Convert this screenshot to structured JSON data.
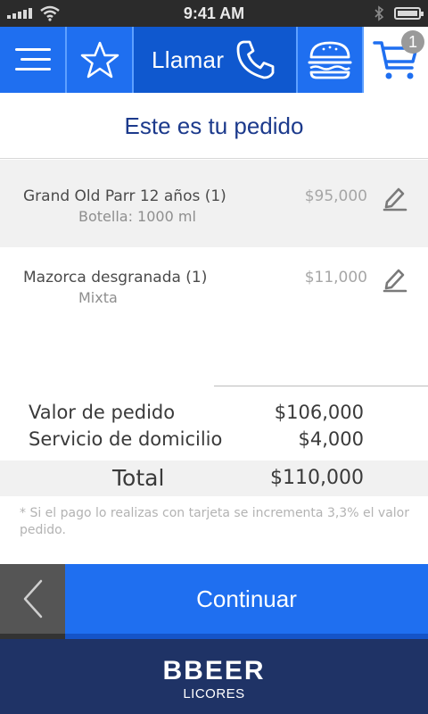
{
  "status_bar": {
    "time": "9:41 AM",
    "icons": [
      "signal-icon",
      "wifi-icon",
      "bluetooth-icon",
      "battery-icon"
    ]
  },
  "nav": {
    "menu_icon": "menu-icon",
    "favorites_icon": "star-icon",
    "call_label": "Llamar",
    "call_icon": "phone-icon",
    "food_icon": "burger-icon",
    "cart_icon": "cart-icon",
    "cart_count": "1"
  },
  "order": {
    "title": "Este es tu pedido",
    "items": [
      {
        "name": "Grand Old Parr 12 años (1)",
        "detail": "Botella: 1000 ml",
        "price": "$95,000"
      },
      {
        "name": "Mazorca desgranada (1)",
        "detail": "Mixta",
        "price": "$11,000"
      }
    ]
  },
  "summary": {
    "subtotal_label": "Valor de pedido",
    "subtotal_value": "$106,000",
    "delivery_label": "Servicio de domicilio",
    "delivery_value": "$4,000",
    "total_label": "Total",
    "total_value": "$110,000",
    "note": "* Si el pago lo realizas con tarjeta se incrementa 3,3% el valor pedido."
  },
  "actions": {
    "back_icon": "chevron-left-icon",
    "continue_label": "Continuar"
  },
  "footer": {
    "brand": "BBEER",
    "brand_sub": "LICORES"
  },
  "colors": {
    "primary": "#1f6ff0",
    "primary_dark": "#0f58cf",
    "footer": "#1f3366",
    "title": "#1c3a8c"
  }
}
